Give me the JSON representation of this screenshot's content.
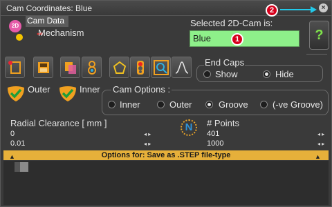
{
  "window": {
    "title": "Cam Coordinates: Blue",
    "close_glyph": "×"
  },
  "markers": {
    "one": "1",
    "two": "2"
  },
  "tree": {
    "badge": "2D",
    "items": [
      {
        "label": "Cam Data"
      },
      {
        "label": "Mechanism"
      }
    ]
  },
  "selected": {
    "label": "Selected 2D-Cam is:",
    "value": "Blue"
  },
  "help_label": "?",
  "toolbar": {
    "icons": [
      "new-cam-icon",
      "save-icon",
      "copy-icon",
      "user-icon",
      "shape-icon",
      "traffic-light-icon",
      "zoom-icon",
      "curve-icon"
    ]
  },
  "end_caps": {
    "legend": "End Caps",
    "show": "Show",
    "hide": "Hide",
    "selected": "Hide"
  },
  "checks": {
    "outer": "Outer",
    "inner": "Inner"
  },
  "cam_options": {
    "legend": "Cam Options :",
    "inner": "Inner",
    "outer": "Outer",
    "groove": "Groove",
    "ve_groove": "(-ve Groove)",
    "selected": "Groove"
  },
  "radial": {
    "label": "Radial Clearance [ mm ]",
    "values": [
      "0",
      "0.01"
    ]
  },
  "points": {
    "label": "# Points",
    "values": [
      "401",
      "1000"
    ]
  },
  "n_icon": "N",
  "banner": {
    "text": "Options for: Save as .STEP file-type"
  },
  "colors": {
    "accent_green": "#8ef08a",
    "banner": "#e6b03a",
    "marker": "#d6001c",
    "arrow": "#22c9e9"
  }
}
